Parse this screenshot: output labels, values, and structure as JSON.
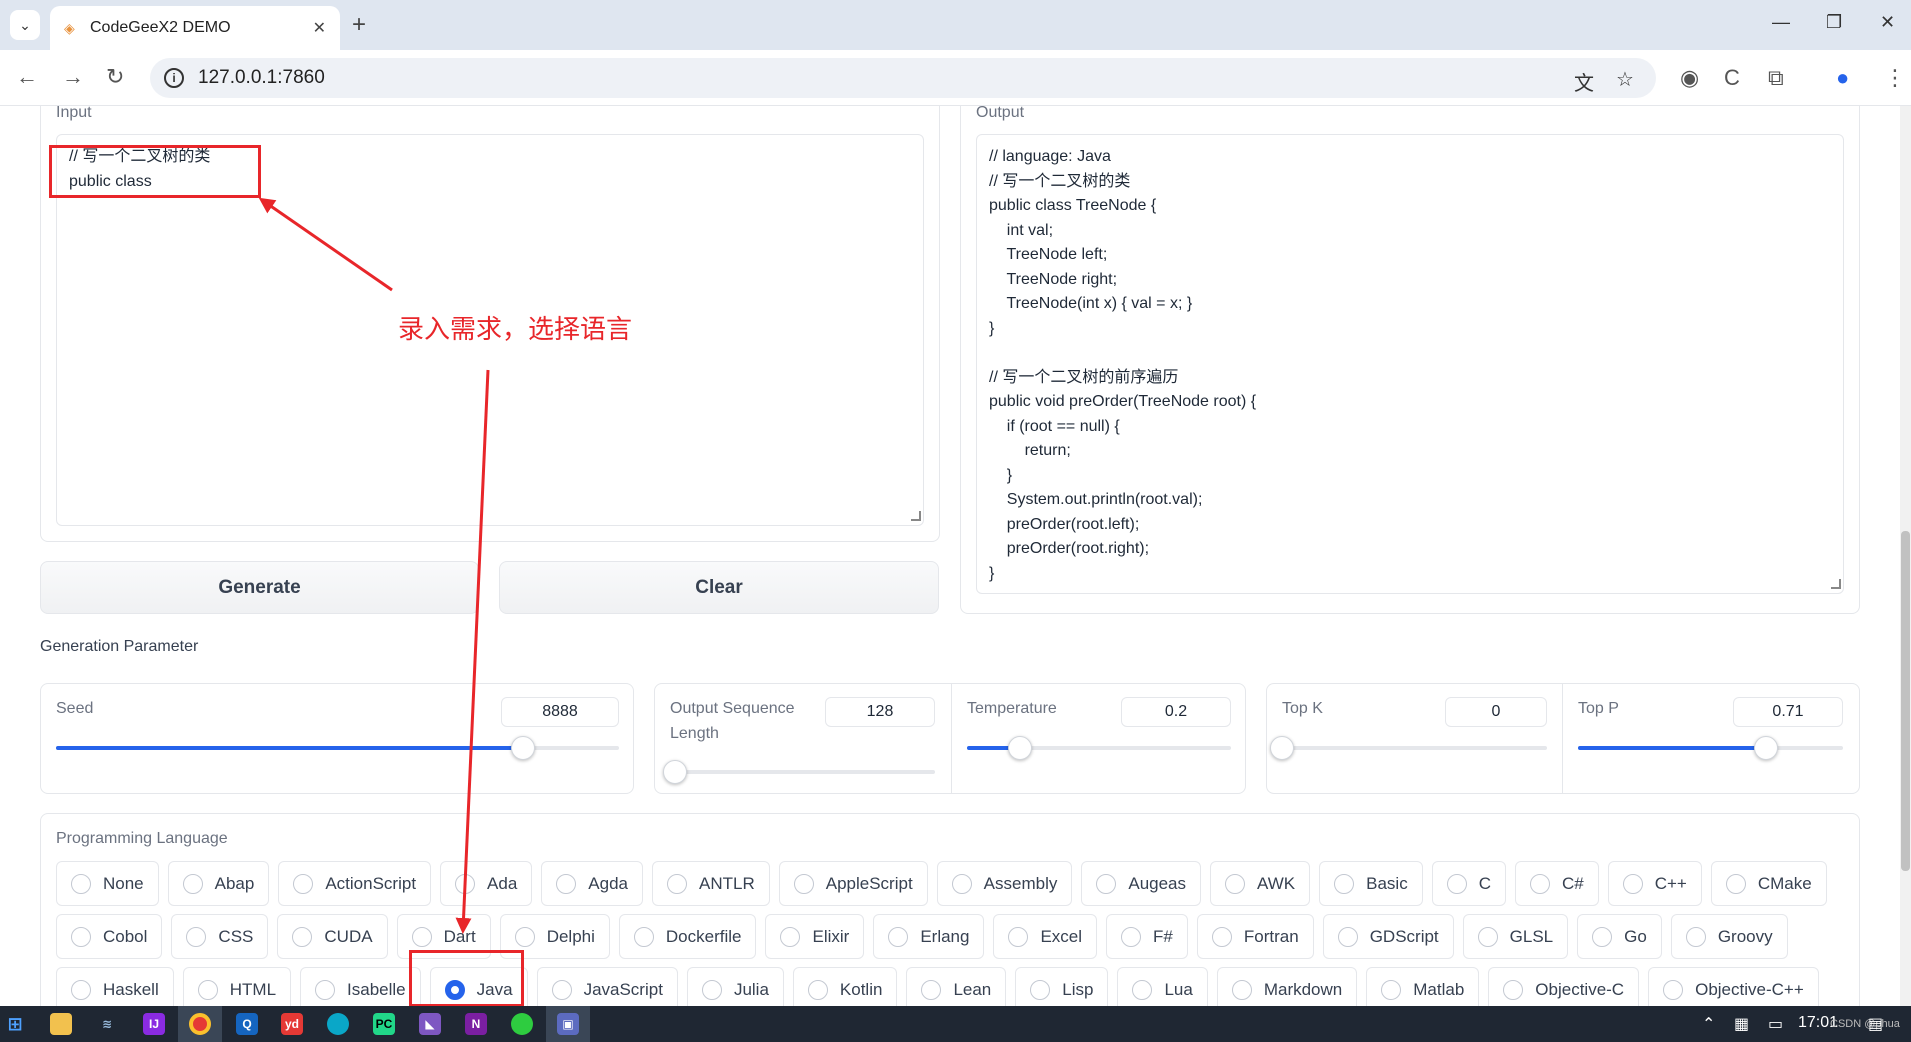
{
  "browser": {
    "tab_title": "CodeGeeX2 DEMO",
    "url": "127.0.0.1:7860"
  },
  "input": {
    "label": "Input",
    "value": "// 写一个二叉树的类\npublic class"
  },
  "output": {
    "label": "Output",
    "value": "// language: Java\n// 写一个二叉树的类\npublic class TreeNode {\n    int val;\n    TreeNode left;\n    TreeNode right;\n    TreeNode(int x) { val = x; }\n}\n\n// 写一个二叉树的前序遍历\npublic void preOrder(TreeNode root) {\n    if (root == null) {\n        return;\n    }\n    System.out.println(root.val);\n    preOrder(root.left);\n    preOrder(root.right);\n}"
  },
  "buttons": {
    "generate": "Generate",
    "clear": "Clear"
  },
  "params": {
    "title": "Generation Parameter",
    "seed": {
      "label": "Seed",
      "value": "8888",
      "fraction": 0.83
    },
    "output_len": {
      "label": "Output Sequence Length",
      "value": "128",
      "fraction": 0.02
    },
    "temperature": {
      "label": "Temperature",
      "value": "0.2",
      "fraction": 0.2
    },
    "top_k": {
      "label": "Top K",
      "value": "0",
      "fraction": 0.0
    },
    "top_p": {
      "label": "Top P",
      "value": "0.71",
      "fraction": 0.71
    }
  },
  "languages": {
    "label": "Programming Language",
    "selected": "Java",
    "rows": [
      [
        "None",
        "Abap",
        "ActionScript",
        "Ada",
        "Agda",
        "ANTLR",
        "AppleScript",
        "Assembly",
        "Augeas",
        "AWK",
        "Basic",
        "C",
        "C#",
        "C++",
        "CMake"
      ],
      [
        "Cobol",
        "CSS",
        "CUDA",
        "Dart",
        "Delphi",
        "Dockerfile",
        "Elixir",
        "Erlang",
        "Excel",
        "F#",
        "Fortran",
        "GDScript",
        "GLSL",
        "Go",
        "Groovy"
      ],
      [
        "Haskell",
        "HTML",
        "Isabelle",
        "Java",
        "JavaScript",
        "Julia",
        "Kotlin",
        "Lean",
        "Lisp",
        "Lua",
        "Markdown",
        "Matlab",
        "Objective-C",
        "Objective-C++"
      ]
    ]
  },
  "annotation": {
    "text": "录入需求，选择语言",
    "color": "#e8262a"
  },
  "taskbar": {
    "time": "17:01",
    "watermark": "CSDN @phua"
  }
}
